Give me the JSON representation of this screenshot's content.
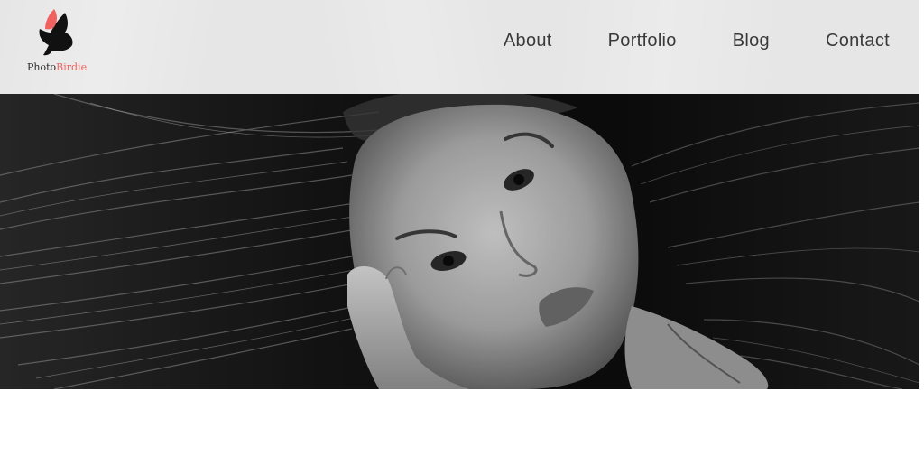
{
  "brand": {
    "name_part1": "Photo",
    "name_part2": "Birdie",
    "logo_icon": "bird-logo-icon",
    "accent_color": "#f0615f",
    "dark_color": "#111111"
  },
  "nav": {
    "items": [
      {
        "label": "About"
      },
      {
        "label": "Portfolio"
      },
      {
        "label": "Blog"
      },
      {
        "label": "Contact"
      }
    ]
  },
  "hero": {
    "image": "hero-portrait-image"
  }
}
